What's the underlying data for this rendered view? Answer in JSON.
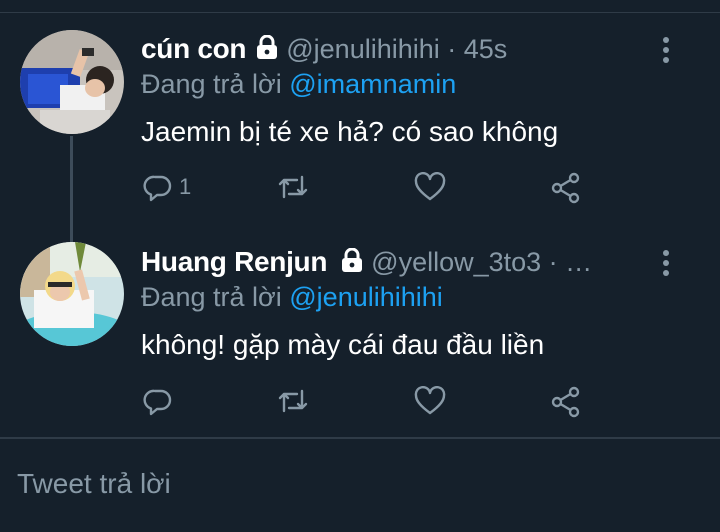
{
  "tweets": [
    {
      "name": "cún con",
      "handle": "@jenulihihihi · 45s",
      "replying_prefix": "Đang trả lời ",
      "replying_to": "@imamnamin",
      "text": "Jaemin bị té xe hả? có sao không",
      "reply_count": "1",
      "avatar_icon": "profile-photo"
    },
    {
      "name": "Huang Renjun",
      "handle": "@yellow_3to3 · …",
      "replying_prefix": "Đang trả lời ",
      "replying_to": "@jenulihihihi",
      "text": "không! gặp mày cái đau đầu liền",
      "reply_count": "",
      "avatar_icon": "profile-photo"
    }
  ],
  "composer": {
    "placeholder": "Tweet trả lời"
  },
  "colors": {
    "background": "#15202b",
    "accent": "#1da1f2",
    "muted": "#8899a6",
    "divider": "#2f3b47"
  }
}
